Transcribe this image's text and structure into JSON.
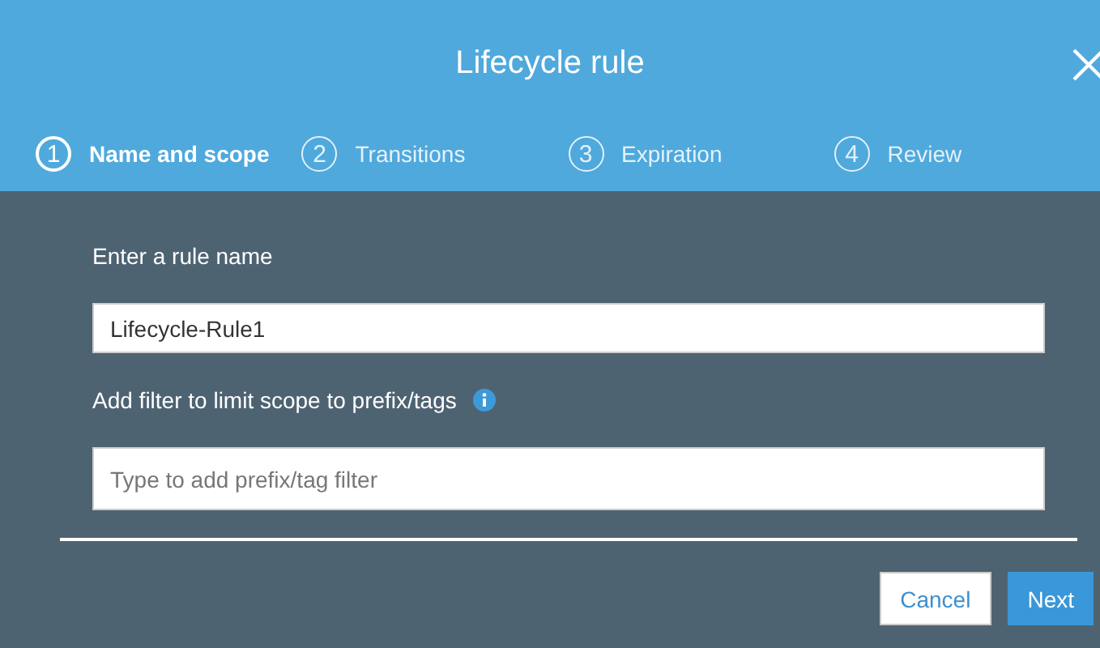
{
  "dialog": {
    "title": "Lifecycle rule"
  },
  "steps": [
    {
      "number": "1",
      "label": "Name and scope",
      "selected": true
    },
    {
      "number": "2",
      "label": "Transitions",
      "selected": false
    },
    {
      "number": "3",
      "label": "Expiration",
      "selected": false
    },
    {
      "number": "4",
      "label": "Review",
      "selected": false
    }
  ],
  "rule_name": {
    "label": "Enter a rule name",
    "value": "Lifecycle-Rule1"
  },
  "filter": {
    "label": "Add filter to limit scope to prefix/tags",
    "placeholder": "Type to add prefix/tag filter"
  },
  "buttons": [
    {
      "label": "Cancel",
      "kind": "secondary"
    },
    {
      "label": "Next",
      "kind": "primary"
    }
  ]
}
